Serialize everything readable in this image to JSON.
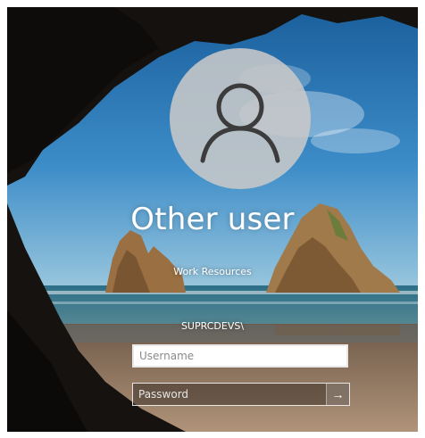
{
  "login": {
    "user_name": "Other user",
    "domain_label": "Work Resources",
    "domain_prefix": "SUPRCDEVS\\",
    "username_placeholder": "Username",
    "password_placeholder": "Password",
    "submit_icon": "arrow-right-icon"
  },
  "colors": {
    "sky": "#1f6aa7",
    "sea": "#3a7a94",
    "sand": "#9b8064",
    "cave": "#14110e",
    "avatar_circle": "#c8c8c8",
    "avatar_glyph": "#3c3c3c"
  }
}
